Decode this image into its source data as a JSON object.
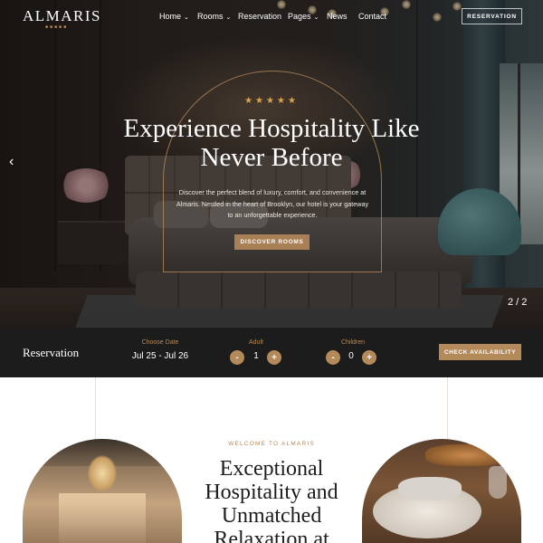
{
  "brand": {
    "logo": "ALMARIS"
  },
  "nav": {
    "items": [
      {
        "label": "Home",
        "dropdown": true
      },
      {
        "label": "Rooms",
        "dropdown": true
      },
      {
        "label": "Reservation",
        "dropdown": false
      },
      {
        "label": "Pages",
        "dropdown": true
      },
      {
        "label": "News",
        "dropdown": false
      },
      {
        "label": "Contact",
        "dropdown": false
      }
    ],
    "caret": "⌄",
    "reservation_button": "RESERVATION"
  },
  "hero": {
    "stars": "★★★★★",
    "headline_line1": "Experience Hospitality Like",
    "headline_line2": "Never Before",
    "subtext": "Discover the perfect blend of luxury, comfort, and convenience at Almaris. Nestled in the heart of Brooklyn, our hotel is your gateway to an unforgettable experience.",
    "cta": "DISCOVER ROOMS",
    "prev_arrow": "‹",
    "slide_counter": "2 / 2"
  },
  "reservation": {
    "title": "Reservation",
    "choose_date_label": "Choose Date",
    "date_value": "Jul 25 - Jul 26",
    "adult_label": "Adult",
    "adult_value": "1",
    "children_label": "Children",
    "children_value": "0",
    "minus": "-",
    "plus": "+",
    "check_button": "CHECK AVAILABILITY"
  },
  "intro": {
    "welcome": "WELCOME TO ALMARIS",
    "heading": "Exceptional Hospitality and Unmatched Relaxation at"
  },
  "colors": {
    "accent": "#b58a5a",
    "dark_bar": "#1c1c1c",
    "stars": "#d9a44c"
  }
}
